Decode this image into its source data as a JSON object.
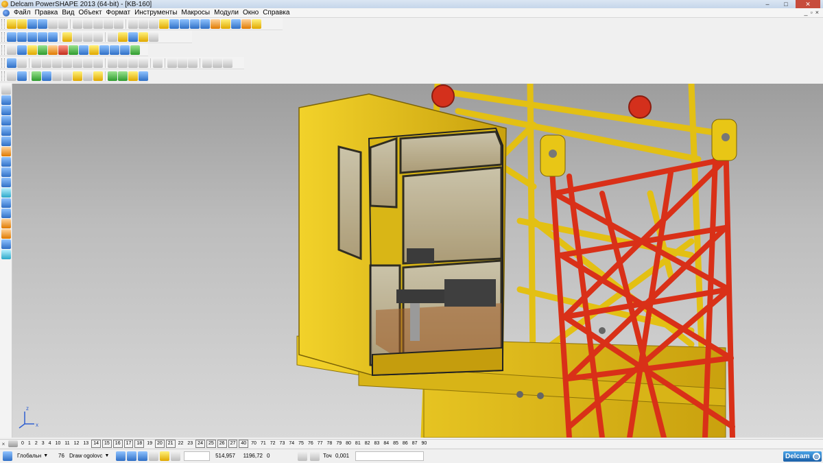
{
  "window": {
    "title": "Delcam PowerSHAPE 2013 (64-bit) - [KB-160]",
    "minimize": "–",
    "maximize": "□",
    "close": "✕"
  },
  "menu": {
    "items": [
      "Файл",
      "Правка",
      "Вид",
      "Объект",
      "Формат",
      "Инструменты",
      "Макросы",
      "Модули",
      "Окно",
      "Справка"
    ],
    "mdi_min": "_",
    "mdi_restore": "▫",
    "mdi_close": "×"
  },
  "levels": {
    "items": [
      "0",
      "1",
      "2",
      "3",
      "4",
      "10",
      "11",
      "12",
      "13",
      "14",
      "15",
      "16",
      "17",
      "18",
      "19",
      "20",
      "21",
      "22",
      "23",
      "24",
      "25",
      "26",
      "27",
      "40",
      "70",
      "71",
      "72",
      "73",
      "74",
      "75",
      "76",
      "77",
      "78",
      "79",
      "80",
      "81",
      "82",
      "83",
      "84",
      "85",
      "86",
      "87",
      "90"
    ],
    "boxed": [
      "14",
      "15",
      "16",
      "17",
      "18",
      "20",
      "21",
      "24",
      "25",
      "26",
      "27",
      "40"
    ]
  },
  "status": {
    "workplane": "Глобальн",
    "level_number": "76",
    "level_name": "Draw ogolovc",
    "x": "514,957",
    "y": "1196,72",
    "z": "0",
    "tolerance_label": "Точ",
    "tolerance_value": "0,001",
    "brand": "Delcam"
  },
  "colors": {
    "cab_yellow": "#e6c11a",
    "mast_red": "#e0321e",
    "viewport_top": "#9d9d9d",
    "viewport_bottom": "#d9d9d9"
  },
  "axis": {
    "x": "x",
    "z": "z"
  }
}
